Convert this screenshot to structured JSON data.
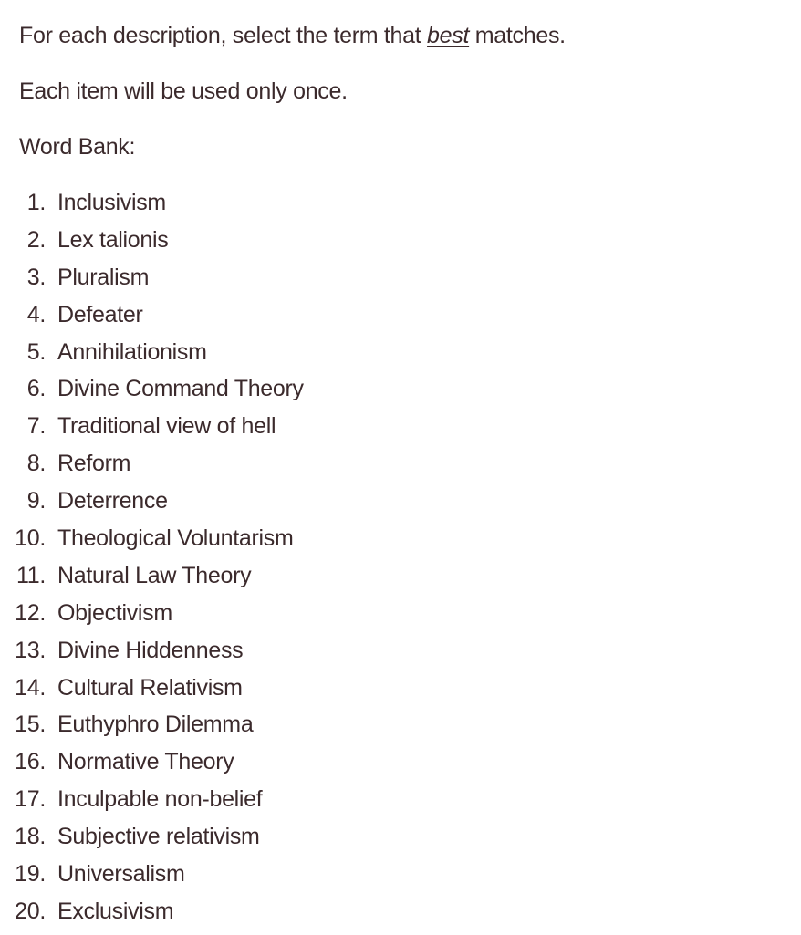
{
  "instructions": {
    "line1_before": "For each description, select the term that ",
    "line1_emphasis": "best",
    "line1_after": " matches.",
    "line2": "Each item will be used only once.",
    "line3": "Word Bank:"
  },
  "colors": {
    "text": "#3b2a2c",
    "background": "#ffffff"
  },
  "word_bank": [
    {
      "number": "1.",
      "term": "Inclusivism"
    },
    {
      "number": "2.",
      "term": "Lex talionis"
    },
    {
      "number": "3.",
      "term": "Pluralism"
    },
    {
      "number": "4.",
      "term": "Defeater"
    },
    {
      "number": "5.",
      "term": "Annihilationism"
    },
    {
      "number": "6.",
      "term": "Divine Command Theory"
    },
    {
      "number": "7.",
      "term": "Traditional view of hell"
    },
    {
      "number": "8.",
      "term": "Reform"
    },
    {
      "number": "9.",
      "term": "Deterrence"
    },
    {
      "number": "10.",
      "term": "Theological Voluntarism"
    },
    {
      "number": "11.",
      "term": "Natural Law Theory"
    },
    {
      "number": "12.",
      "term": "Objectivism"
    },
    {
      "number": "13.",
      "term": "Divine Hiddenness"
    },
    {
      "number": "14.",
      "term": "Cultural Relativism"
    },
    {
      "number": "15.",
      "term": "Euthyphro Dilemma"
    },
    {
      "number": "16.",
      "term": "Normative Theory"
    },
    {
      "number": "17.",
      "term": "Inculpable non-belief"
    },
    {
      "number": "18.",
      "term": "Subjective relativism"
    },
    {
      "number": "19.",
      "term": "Universalism"
    },
    {
      "number": "20.",
      "term": "Exclusivism"
    }
  ]
}
